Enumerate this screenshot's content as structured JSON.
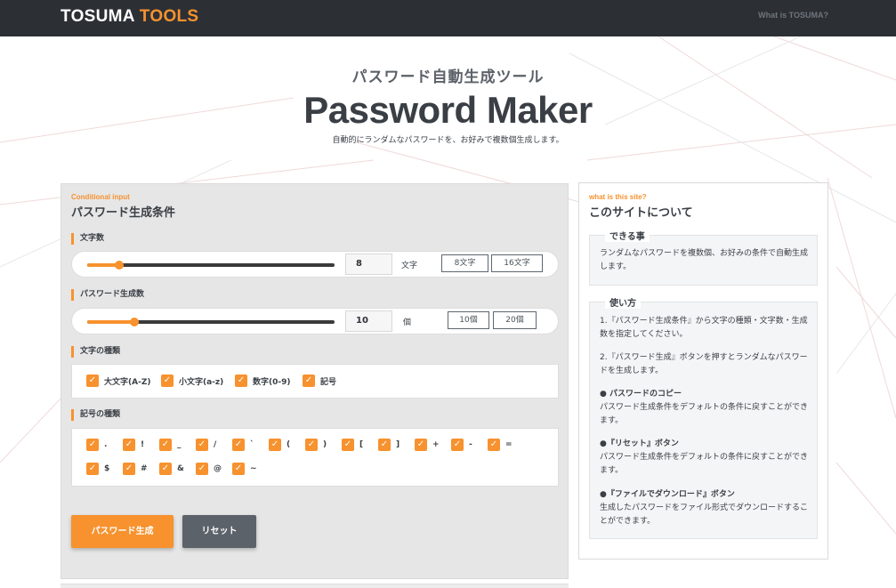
{
  "header": {
    "logo_part1": "TOSUMA",
    "logo_part2": "TOOLS",
    "nav_link": "What is TOSUMA?"
  },
  "hero": {
    "subtitle": "パスワード自動生成ツール",
    "title": "Password Maker",
    "description": "自動的にランダムなパスワードを、お好みで複数個生成します。"
  },
  "form": {
    "tag": "Conditional input",
    "title": "パスワード生成条件",
    "length": {
      "label": "文字数",
      "value": "8",
      "unit": "文字",
      "slider_fraction": 0.13,
      "presets": [
        "8文字",
        "16文字"
      ]
    },
    "count": {
      "label": "パスワード生成数",
      "value": "10",
      "unit": "個",
      "slider_fraction": 0.19,
      "presets": [
        "10個",
        "20個"
      ]
    },
    "char_types": {
      "label": "文字の種類",
      "items": [
        "大文字(A-Z)",
        "小文字(a-z)",
        "数字(0-9)",
        "記号"
      ]
    },
    "symbol_types": {
      "label": "記号の種類",
      "row1": [
        ".",
        "!",
        "_",
        "/",
        "`",
        "(",
        ")",
        "[",
        "]",
        "+",
        "-",
        "="
      ],
      "row2": [
        "$",
        "#",
        "&",
        "@",
        "~"
      ]
    },
    "generate_label": "パスワード生成",
    "reset_label": "リセット"
  },
  "about": {
    "tag": "what is this site?",
    "title": "このサイトについて",
    "can_do": {
      "legend": "できる事",
      "text": "ランダムなパスワードを複数個、お好みの条件で自動生成します。"
    },
    "how_to": {
      "legend": "使い方",
      "step1": "1.『パスワード生成条件』から文字の種類・文字数・生成数を指定してください。",
      "step2": "2.『パスワード生成』ボタンを押すとランダムなパスワードを生成します。",
      "copy_title": "● パスワードのコピー",
      "copy_text": "パスワード生成条件をデフォルトの条件に戻すことができます。",
      "reset_title": "●『リセット』ボタン",
      "reset_text": "パスワード生成条件をデフォルトの条件に戻すことができます。",
      "download_title": "●『ファイルでダウンロード』ボタン",
      "download_text": "生成したパスワードをファイル形式でダウンロードすることができます。"
    }
  },
  "colors": {
    "accent": "#f7922e",
    "header_bg": "#2c3035",
    "panel_bg": "#e6e6e6",
    "reset_button": "#5c6269"
  },
  "icons": {
    "checkbox": "checkmark-icon"
  }
}
